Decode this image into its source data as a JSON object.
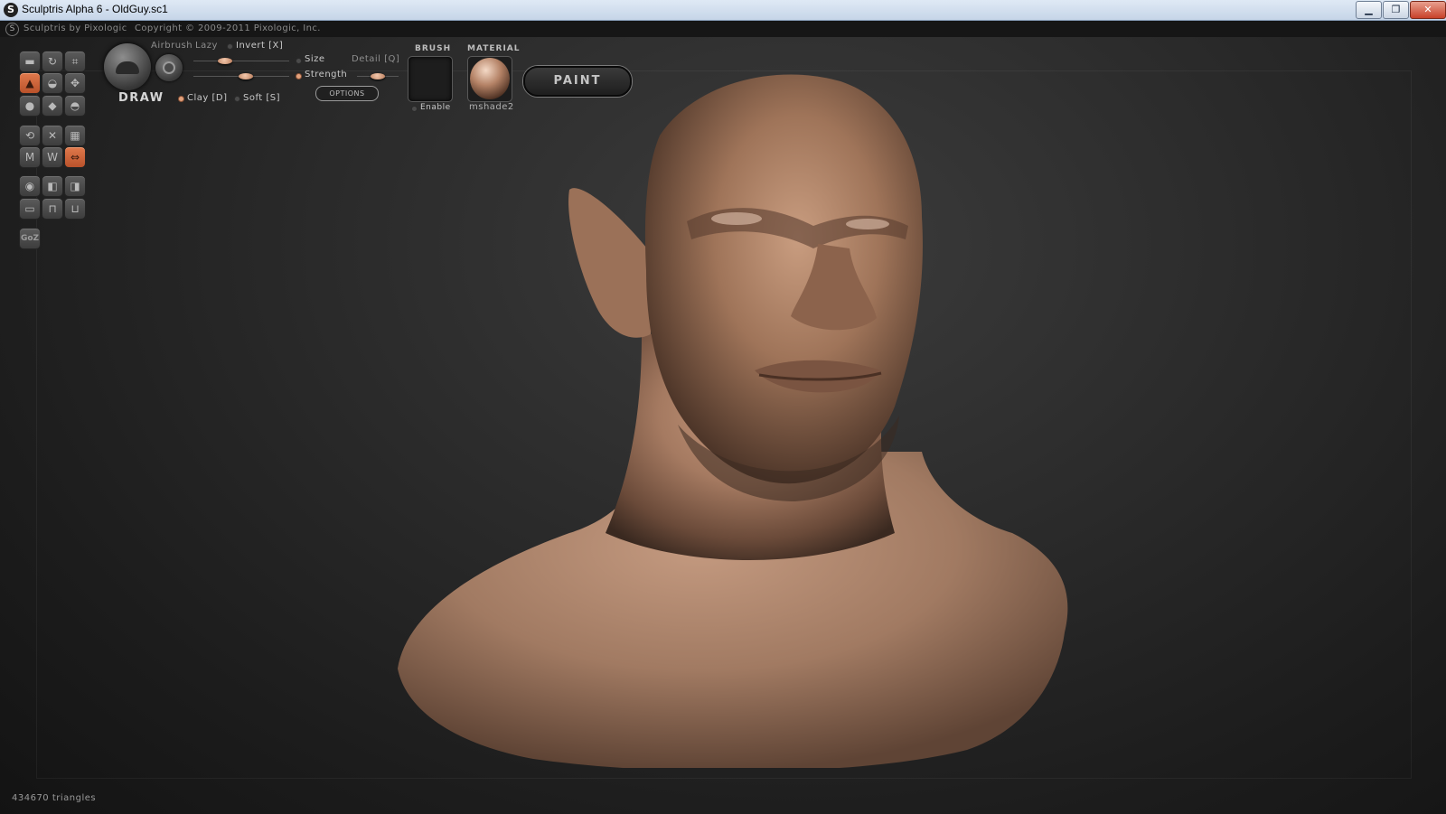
{
  "window": {
    "title": "Sculptris Alpha 6 - OldGuy.sc1",
    "controls": {
      "minimize": "▁",
      "maximize": "❐",
      "close": "✕"
    }
  },
  "infobar": {
    "brand": "Sculptris by Pixologic",
    "copyright": "Copyright © 2009-2011 Pixologic, Inc."
  },
  "tools": {
    "accent_color": "#d0693c",
    "groups": [
      [
        "crease-icon",
        "rotate-icon",
        "crop-icon"
      ],
      [
        "draw-icon",
        "flatten-icon",
        "grab-icon"
      ],
      [
        "inflate-icon",
        "pinch-icon",
        "smooth-icon"
      ],
      [
        "twist-icon",
        "reduce-icon",
        "grid-icon"
      ],
      [
        "mask-icon",
        "wave-icon",
        "symmetry-icon"
      ],
      [
        "sphere-icon",
        "load-icon",
        "save-icon"
      ],
      [
        "plane-icon",
        "export-icon",
        "import-icon"
      ]
    ],
    "goz": "GoZ"
  },
  "toolbar": {
    "mode_label": "DRAW",
    "airbrush": "Airbrush",
    "lazy": "Lazy",
    "invert": "Invert [X]",
    "size": "Size",
    "detail": "Detail [Q]",
    "strength": "Strength",
    "clay": "Clay [D]",
    "soft": "Soft [S]",
    "options": "OPTIONS",
    "size_value": 0.33,
    "strength_value": 0.55,
    "detail_value": 0.5
  },
  "brush": {
    "title": "BRUSH",
    "enable": "Enable"
  },
  "material": {
    "title": "MATERIAL",
    "name": "mshade2"
  },
  "paint_button": "PAINT",
  "status": {
    "triangles": "434670 triangles"
  }
}
